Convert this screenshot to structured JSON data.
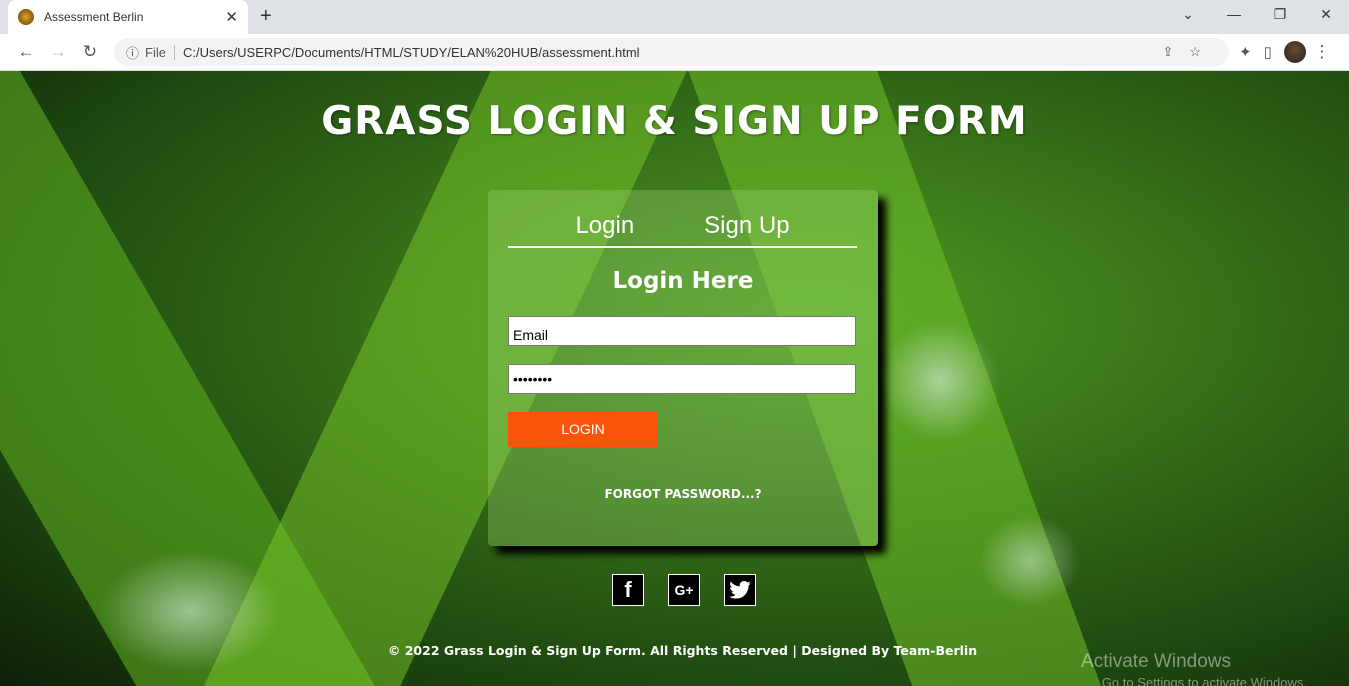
{
  "browser": {
    "tab_title": "Assessment Berlin",
    "url_scheme": "File",
    "url": "C:/Users/USERPC/Documents/HTML/STUDY/ELAN%20HUB/assessment.html"
  },
  "page": {
    "title": "GRASS LOGIN & SIGN UP FORM",
    "tabs": [
      {
        "label": "Login"
      },
      {
        "label": "Sign Up"
      }
    ],
    "heading": "Login Here",
    "email_value": "Email",
    "password_value": "••••••••",
    "login_button": "LOGIN",
    "forgot": "FORGOT PASSWORD...?",
    "social": [
      {
        "icon": "facebook-icon",
        "glyph": "f"
      },
      {
        "icon": "google-plus-icon",
        "glyph": "G+"
      },
      {
        "icon": "twitter-icon",
        "glyph": "🐦"
      }
    ],
    "footer": "© 2022 Grass Login & Sign Up Form. All Rights Reserved | Designed By Team-Berlin"
  },
  "watermark": {
    "line1": "Activate Windows",
    "line2": "Go to Settings to activate Windows."
  },
  "colors": {
    "button": "#fa5408"
  }
}
